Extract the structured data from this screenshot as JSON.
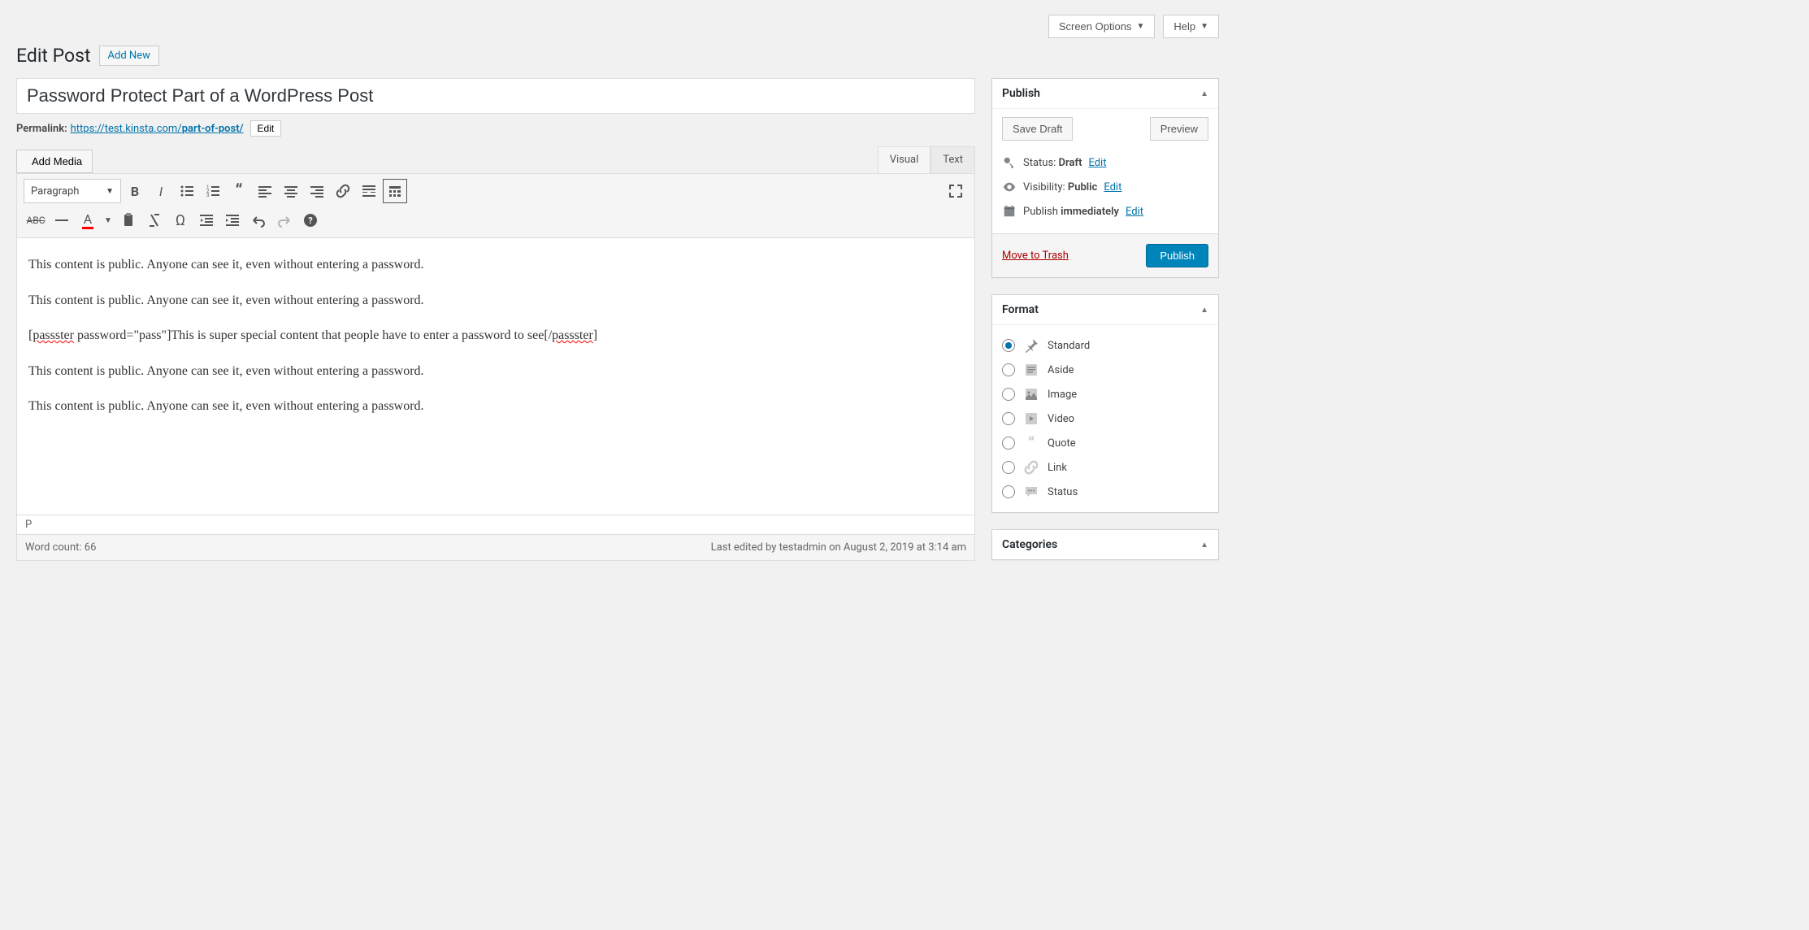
{
  "topbar": {
    "screen_options": "Screen Options",
    "help": "Help"
  },
  "header": {
    "page_title": "Edit Post",
    "add_new": "Add New"
  },
  "post": {
    "title": "Password Protect Part of a WordPress Post",
    "permalink_label": "Permalink:",
    "permalink_base": "https://test.kinsta.com/",
    "permalink_slug": "part-of-post/",
    "edit_slug": "Edit"
  },
  "editor": {
    "add_media": "Add Media",
    "tabs": {
      "visual": "Visual",
      "text": "Text"
    },
    "format_selector": "Paragraph",
    "content": {
      "p1": "This content is public. Anyone can see it, even without entering a password.",
      "p2": "This content is public. Anyone can see it, even without entering a password.",
      "p3_open_tag": "passster",
      "p3_attr": " password=\"pass\"]This is super special content that people have to enter a password to see[/",
      "p3_close_tag": "passster",
      "p4": "This content is public. Anyone can see it, even without entering a password.",
      "p5": "This content is public. Anyone can see it, even without entering a password."
    },
    "path": "P",
    "word_count_label": "Word count: ",
    "word_count": "66",
    "last_edited": "Last edited by testadmin on August 2, 2019 at 3:14 am"
  },
  "publish": {
    "title": "Publish",
    "save_draft": "Save Draft",
    "preview": "Preview",
    "status_label": "Status: ",
    "status_value": "Draft",
    "visibility_label": "Visibility: ",
    "visibility_value": "Public",
    "schedule_label": "Publish ",
    "schedule_value": "immediately",
    "edit": "Edit",
    "trash": "Move to Trash",
    "publish_btn": "Publish"
  },
  "format": {
    "title": "Format",
    "options": [
      {
        "label": "Standard",
        "checked": true
      },
      {
        "label": "Aside",
        "checked": false
      },
      {
        "label": "Image",
        "checked": false
      },
      {
        "label": "Video",
        "checked": false
      },
      {
        "label": "Quote",
        "checked": false
      },
      {
        "label": "Link",
        "checked": false
      },
      {
        "label": "Status",
        "checked": false
      }
    ]
  },
  "categories": {
    "title": "Categories"
  }
}
